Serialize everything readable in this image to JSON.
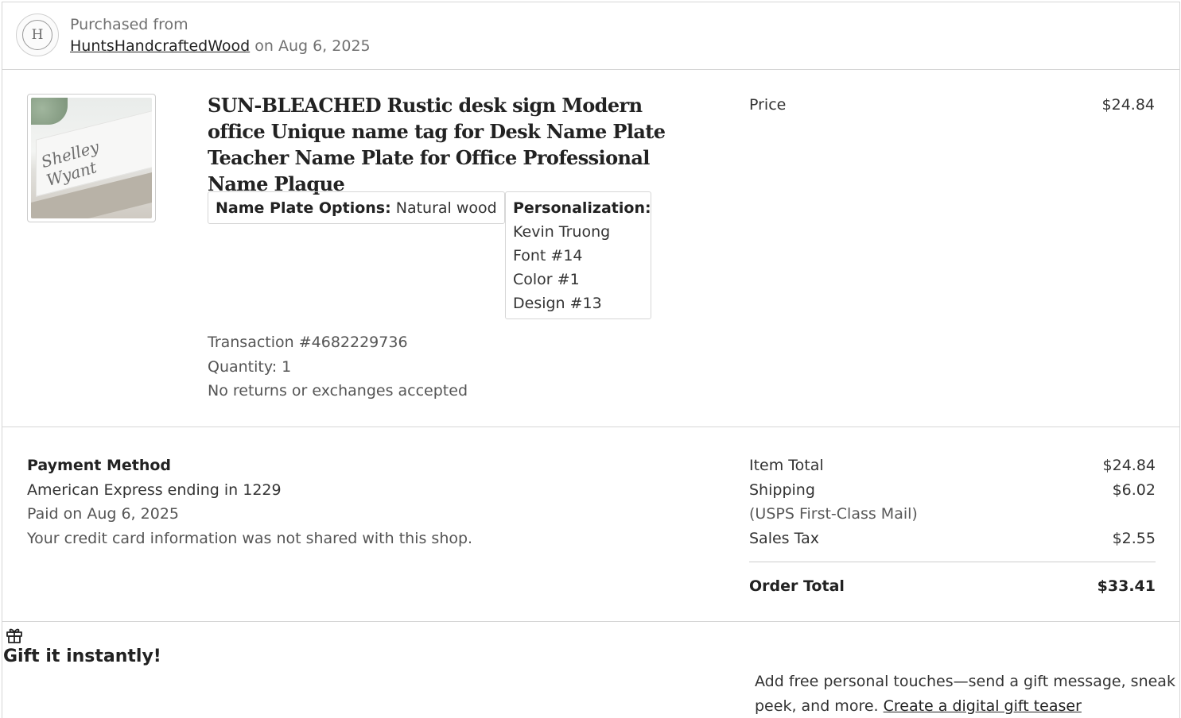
{
  "header": {
    "purchased_label": "Purchased from",
    "shop_name": "HuntsHandcraftedWood",
    "purchase_date_text": "on Aug 6, 2025",
    "logo_letter": "H"
  },
  "item": {
    "thumbnail_script": "Shelley Wyant",
    "title": "SUN-BLEACHED Rustic desk sign Modern office Unique name tag for Desk Name Plate Teacher Name Plate for Office Professional Name Plaque",
    "variations": [
      {
        "label": "Name Plate Options:",
        "value": "Natural wood"
      },
      {
        "label": "Personalization:",
        "lines": [
          "Kevin Truong",
          "Font #14",
          "Color #1",
          "Design #13"
        ]
      }
    ],
    "transaction": "Transaction #4682229736",
    "quantity": "Quantity: 1",
    "returns_policy": "No returns or exchanges accepted",
    "price_label": "Price",
    "price_value": "$24.84"
  },
  "payment": {
    "heading": "Payment Method",
    "card": "American Express ending in 1229",
    "paid_on": "Paid on Aug 6, 2025",
    "privacy_note": "Your credit card information was not shared with this shop."
  },
  "totals": {
    "item_total_label": "Item Total",
    "item_total_value": "$24.84",
    "shipping_label": "Shipping",
    "shipping_value": "$6.02",
    "shipping_method": "(USPS First-Class Mail)",
    "sales_tax_label": "Sales Tax",
    "sales_tax_value": "$2.55",
    "order_total_label": "Order Total",
    "order_total_value": "$33.41"
  },
  "gift": {
    "icon": "gift-icon",
    "title": "Gift it instantly!",
    "description": "Add free personal touches—send a gift message, sneak peek, and more.",
    "link_text": "Create a digital gift teaser"
  }
}
